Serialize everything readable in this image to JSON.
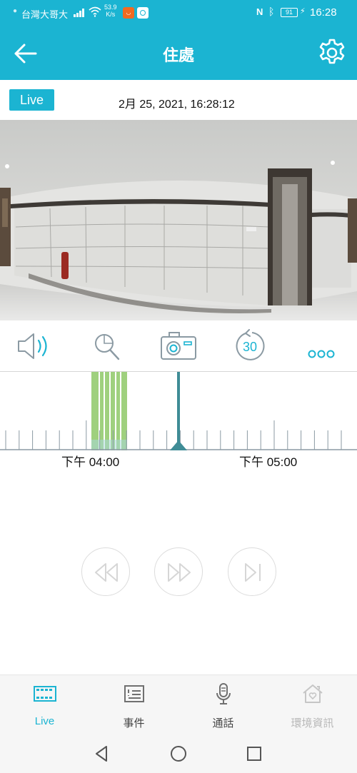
{
  "status_bar": {
    "carrier": "台灣大哥大",
    "net_speed_value": "53.9",
    "net_speed_unit": "K/s",
    "battery": "91",
    "time": "16:28",
    "icons": [
      "signal-icon",
      "wifi-icon",
      "nfc-icon",
      "bluetooth-icon",
      "battery-icon",
      "charging-icon"
    ]
  },
  "header": {
    "title": "住處",
    "back_icon": "arrow-left-icon",
    "settings_icon": "gear-icon",
    "color": "#1bb4d2"
  },
  "live": {
    "badge": "Live",
    "timestamp": "2月 25,  2021, 16:28:12"
  },
  "controls": {
    "items": [
      {
        "icon": "speaker-icon"
      },
      {
        "icon": "zoom-search-icon"
      },
      {
        "icon": "camera-snapshot-icon"
      },
      {
        "icon": "replay-30-icon",
        "label": "30"
      },
      {
        "icon": "more-icon"
      }
    ]
  },
  "timeline": {
    "labels": [
      "下午 04:00",
      "下午 05:00"
    ],
    "event_color": "#9fd07e",
    "cursor_color": "#3f8c96"
  },
  "playback": {
    "buttons": [
      {
        "icon": "rewind-icon"
      },
      {
        "icon": "fast-forward-icon"
      },
      {
        "icon": "skip-to-end-icon"
      }
    ]
  },
  "bottom_nav": {
    "active_color": "#1bb4d2",
    "items": [
      {
        "label": "Live",
        "icon": "film-icon",
        "active": true
      },
      {
        "label": "事件",
        "icon": "event-list-icon",
        "active": false
      },
      {
        "label": "通話",
        "icon": "microphone-icon",
        "active": false
      },
      {
        "label": "環境資訊",
        "icon": "home-heart-icon",
        "active": false,
        "disabled": true
      }
    ]
  },
  "system_nav": {
    "buttons": [
      {
        "icon": "back-triangle-icon"
      },
      {
        "icon": "home-circle-icon"
      },
      {
        "icon": "recents-square-icon"
      }
    ]
  }
}
